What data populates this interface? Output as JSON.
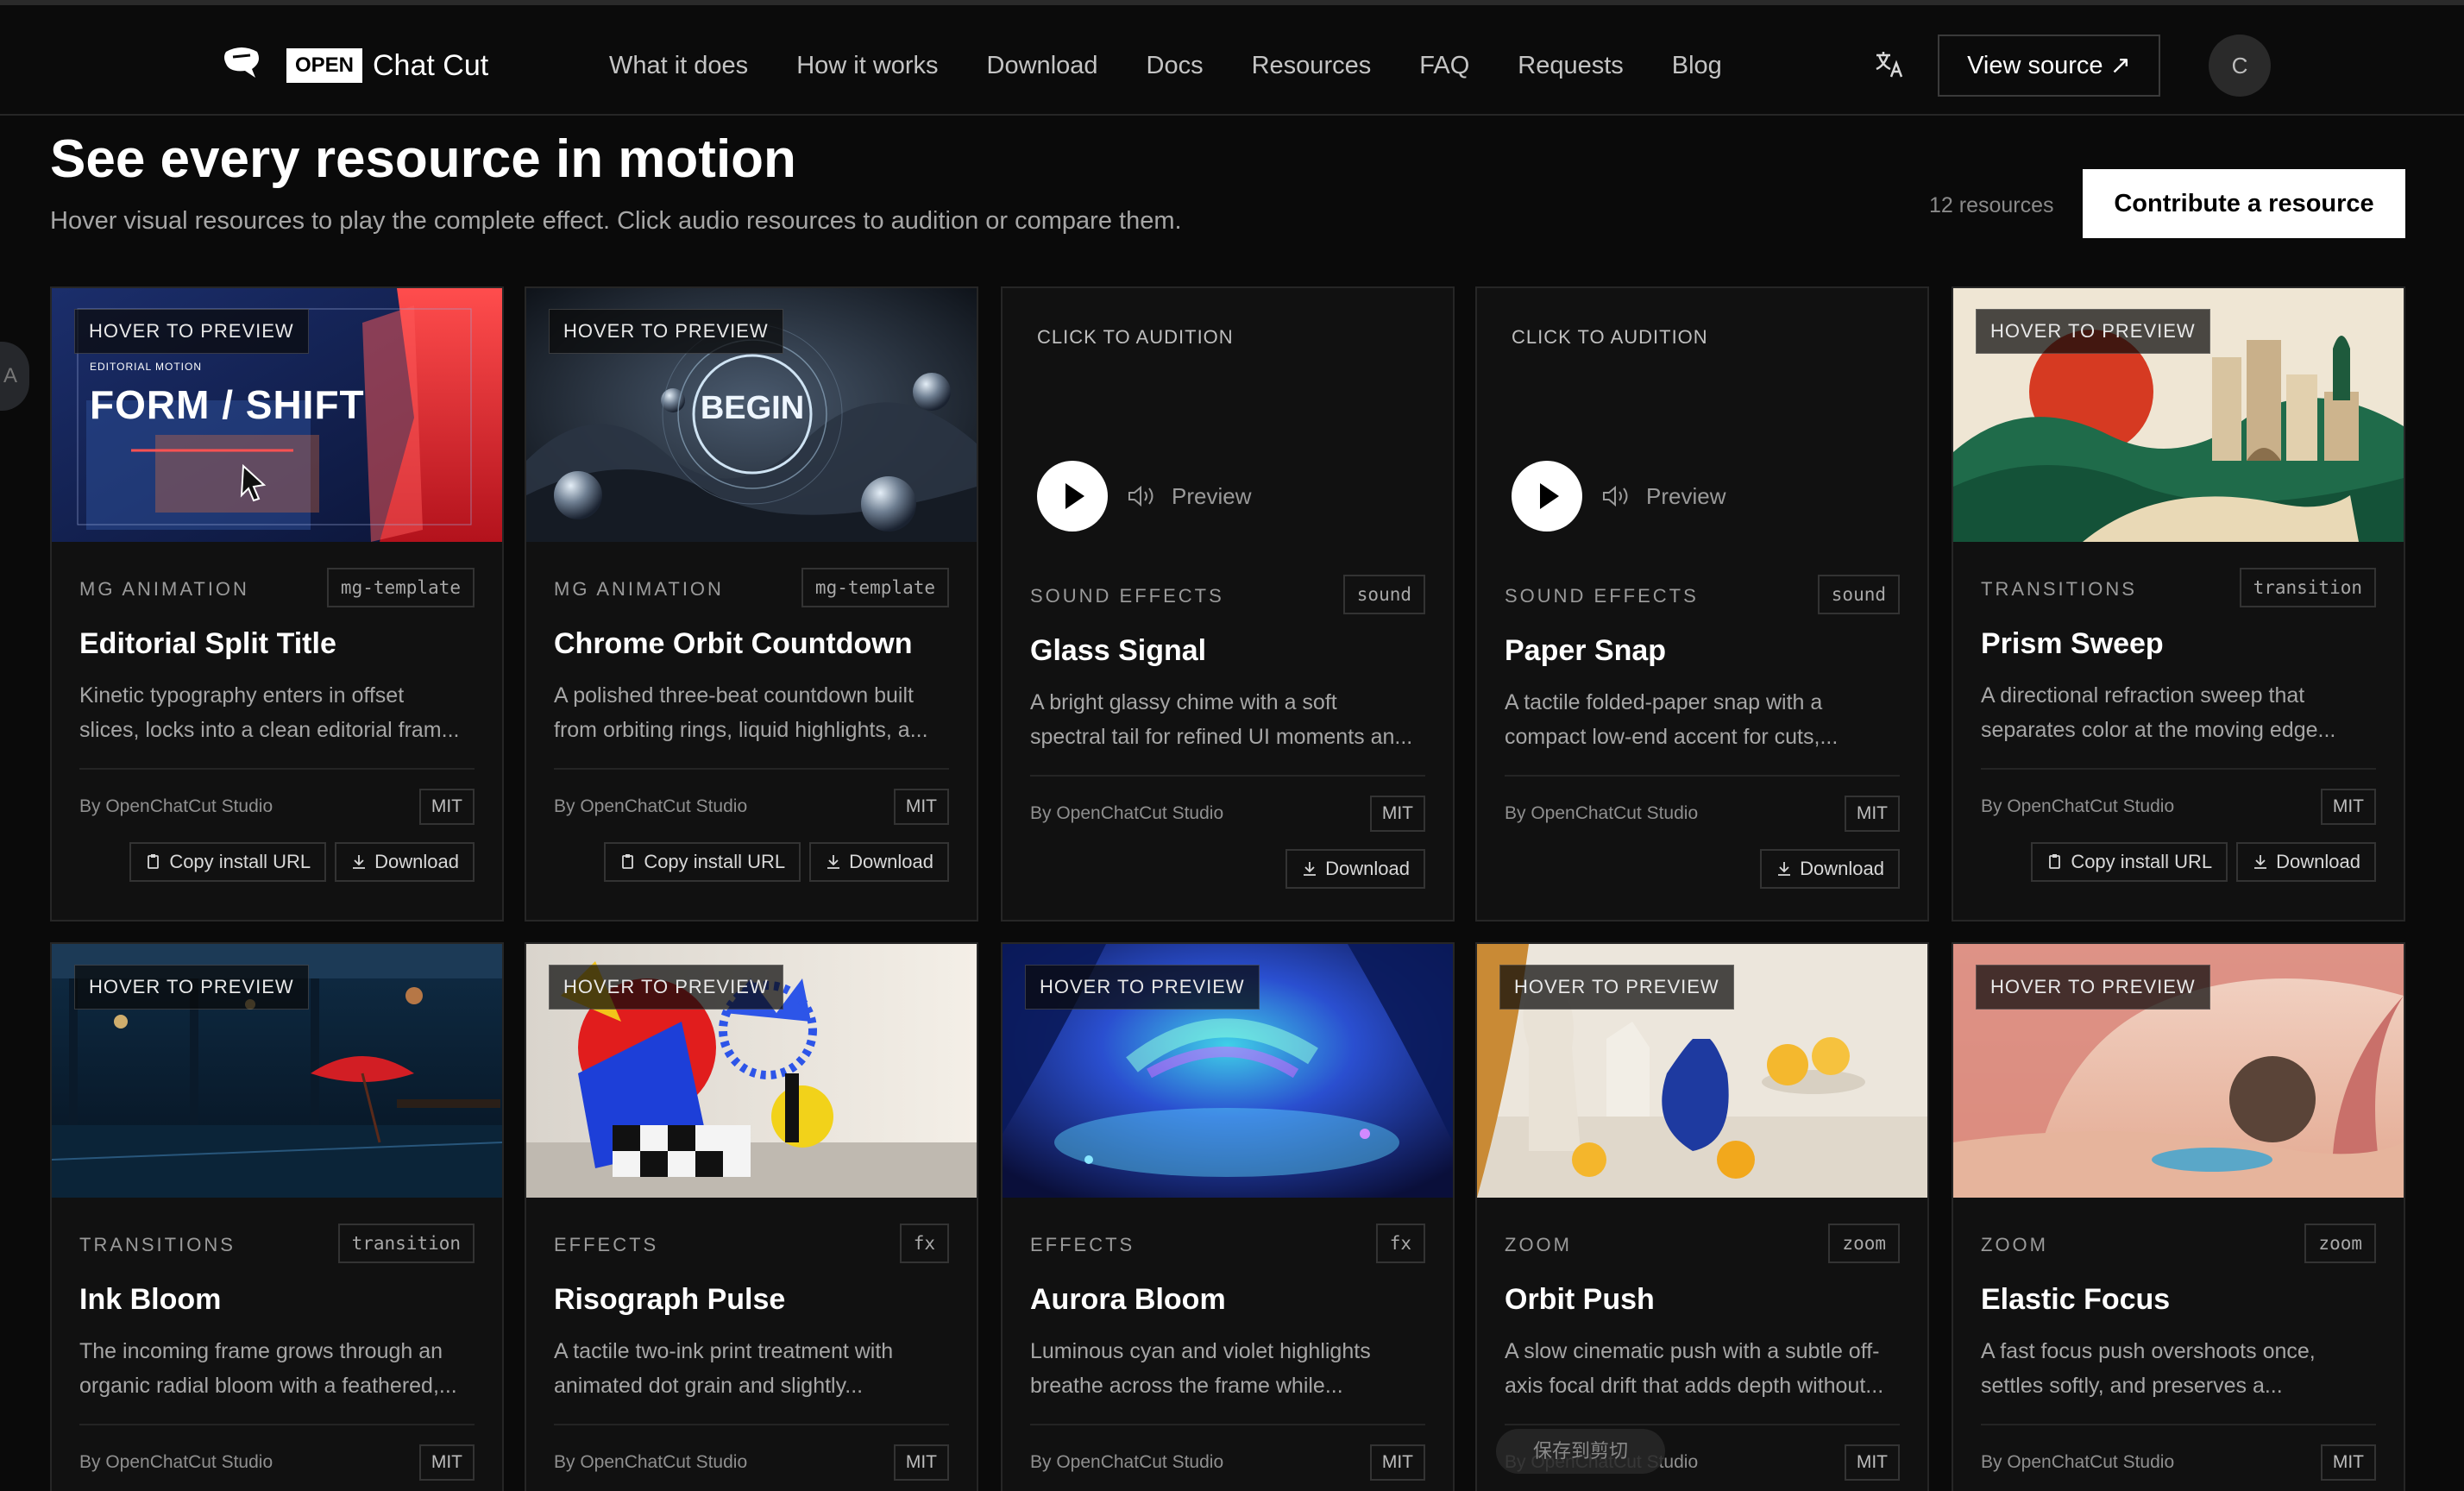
{
  "nav": {
    "logo_badge": "OPEN",
    "logo_text": "Chat Cut",
    "links": [
      "What it does",
      "How it works",
      "Download",
      "Docs",
      "Resources",
      "FAQ",
      "Requests",
      "Blog"
    ],
    "view_source": "View source ↗",
    "avatar_initial": "C"
  },
  "header": {
    "title": "See every resource in motion",
    "subtitle": "Hover visual resources to play the complete effect. Click audio resources to audition or compare them.",
    "count": "12 resources",
    "contribute_label": "Contribute a resource",
    "side_tab": "A"
  },
  "labels": {
    "hover": "HOVER TO PREVIEW",
    "audition": "CLICK TO AUDITION",
    "preview": "Preview",
    "copy_url": "Copy install URL",
    "download": "Download",
    "toast": "保存到剪切"
  },
  "cards": [
    {
      "category": "MG ANIMATION",
      "kind": "mg-template",
      "name": "Editorial Split Title",
      "desc1": "Kinetic typography enters in offset",
      "desc2": "slices, locks into a clean editorial fram...",
      "author": "By OpenChatCut Studio",
      "license": "MIT",
      "media_text1": "EDITORIAL MOTION",
      "media_text2": "FORM / SHIFT"
    },
    {
      "category": "MG ANIMATION",
      "kind": "mg-template",
      "name": "Chrome Orbit Countdown",
      "desc1": "A polished three-beat countdown built",
      "desc2": "from orbiting rings, liquid highlights, a...",
      "author": "By OpenChatCut Studio",
      "license": "MIT",
      "media_text1": "BEGIN"
    },
    {
      "category": "SOUND EFFECTS",
      "kind": "sound",
      "name": "Glass Signal",
      "desc1": "A bright glassy chime with a soft",
      "desc2": "spectral tail for refined UI moments an...",
      "author": "By OpenChatCut Studio",
      "license": "MIT"
    },
    {
      "category": "SOUND EFFECTS",
      "kind": "sound",
      "name": "Paper Snap",
      "desc1": "A tactile folded-paper snap with a",
      "desc2": "compact low-end accent for cuts,...",
      "author": "By OpenChatCut Studio",
      "license": "MIT"
    },
    {
      "category": "TRANSITIONS",
      "kind": "transition",
      "name": "Prism Sweep",
      "desc1": "A directional refraction sweep that",
      "desc2": "separates color at the moving edge...",
      "author": "By OpenChatCut Studio",
      "license": "MIT"
    },
    {
      "category": "TRANSITIONS",
      "kind": "transition",
      "name": "Ink Bloom",
      "desc1": "The incoming frame grows through an",
      "desc2": "organic radial bloom with a feathered,...",
      "author": "By OpenChatCut Studio",
      "license": "MIT"
    },
    {
      "category": "EFFECTS",
      "kind": "fx",
      "name": "Risograph Pulse",
      "desc1": "A tactile two-ink print treatment with",
      "desc2": "animated dot grain and slightly...",
      "author": "By OpenChatCut Studio",
      "license": "MIT"
    },
    {
      "category": "EFFECTS",
      "kind": "fx",
      "name": "Aurora Bloom",
      "desc1": "Luminous cyan and violet highlights",
      "desc2": "breathe across the frame while...",
      "author": "By OpenChatCut Studio",
      "license": "MIT"
    },
    {
      "category": "ZOOM",
      "kind": "zoom",
      "name": "Orbit Push",
      "desc1": "A slow cinematic push with a subtle off-",
      "desc2": "axis focal drift that adds depth without...",
      "author": "By OpenChatCut Studio",
      "license": "MIT"
    },
    {
      "category": "ZOOM",
      "kind": "zoom",
      "name": "Elastic Focus",
      "desc1": "A fast focus push overshoots once,",
      "desc2": "settles softly, and preserves a...",
      "author": "By OpenChatCut Studio",
      "license": "MIT"
    }
  ],
  "colors": {
    "accent": "#ffffff",
    "background": "#0a0a0a",
    "card": "#111111",
    "border": "#262626"
  }
}
